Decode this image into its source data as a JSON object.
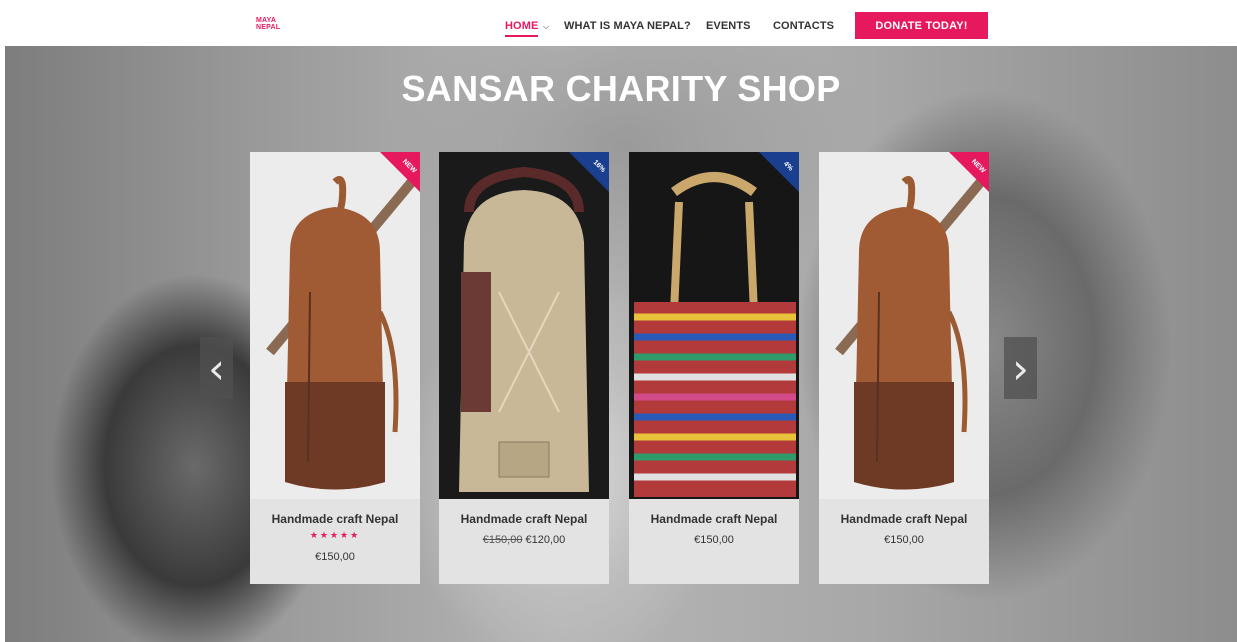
{
  "header": {
    "logo_line1": "MAYA",
    "logo_line2": "NEPAL",
    "nav": [
      {
        "label": "HOME",
        "active": true
      },
      {
        "label": "WHAT IS MAYA NEPAL?"
      },
      {
        "label": "EVENTS"
      },
      {
        "label": "CONTACTS"
      }
    ],
    "donate_label": "DONATE TODAY!"
  },
  "hero": {
    "title": "SANSAR CHARITY SHOP"
  },
  "carousel": {
    "prev_icon": "chevron-left-icon",
    "next_icon": "chevron-right-icon",
    "products": [
      {
        "title": "Handmade craft Nepal",
        "badge": "NEW",
        "badge_color": "#e6195f",
        "stars": "★★★★★",
        "price": "€150,00",
        "image": "leather-backpack"
      },
      {
        "title": "Handmade craft Nepal",
        "badge": "16%",
        "badge_color": "#1a3f8f",
        "old_price": "€150,00",
        "price": "€120,00",
        "image": "hemp-backpack"
      },
      {
        "title": "Handmade craft Nepal",
        "badge": "4%",
        "badge_color": "#1a3f8f",
        "price": "€150,00",
        "image": "woven-tote-bag"
      },
      {
        "title": "Handmade craft Nepal",
        "badge": "NEW",
        "badge_color": "#e6195f",
        "price": "€150,00",
        "image": "leather-backpack"
      }
    ]
  },
  "colors": {
    "accent": "#e6195f",
    "sale_badge": "#1a3f8f",
    "card_bg": "#e3e3e3"
  }
}
